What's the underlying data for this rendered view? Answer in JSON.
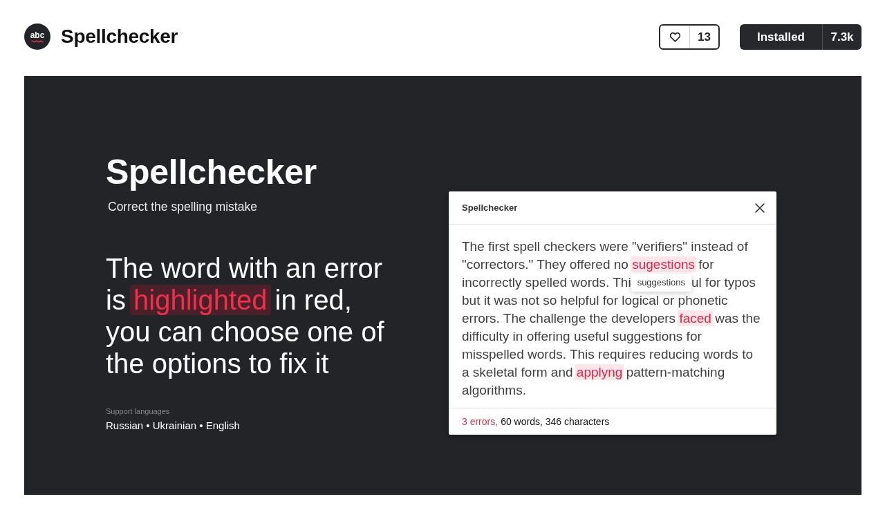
{
  "header": {
    "logo_text": "abc",
    "title": "Spellchecker",
    "like_count": "13",
    "install_label": "Installed",
    "install_count": "7.3k"
  },
  "hero": {
    "title": "Spellchecker",
    "subtitle": "Correct the spelling mistake",
    "headline": [
      {
        "kind": "text",
        "text": "The word with an error is "
      },
      {
        "kind": "error",
        "text": "highlighted"
      },
      {
        "kind": "text",
        "text": " in red, you can choose one of the options to fix it"
      }
    ],
    "languages_label": "Support languages",
    "languages": "Russian • Ukrainian • English"
  },
  "popup": {
    "title": "Spellchecker",
    "text": [
      {
        "kind": "text",
        "text": "The first spell checkers were \"verifiers\" instead of \"correctors.\" They offered no "
      },
      {
        "kind": "error",
        "text": "sugestions"
      },
      {
        "kind": "text",
        "text": " for incorrectly spelled words. Thi"
      },
      {
        "kind": "tooltip",
        "text": "suggestions"
      },
      {
        "kind": "text",
        "text": "ul for typos but it was not so helpful for logical or phonetic errors. The challenge the developers "
      },
      {
        "kind": "error",
        "text": "faced"
      },
      {
        "kind": "text",
        "text": " was the difficulty in offering useful suggestions for misspelled words. This requires reducing words to a skeletal form and "
      },
      {
        "kind": "error",
        "text": "applyng"
      },
      {
        "kind": "text",
        "text": " pattern-matching algorithms."
      }
    ],
    "errors": "3 errors,",
    "counts": "60 words, 346 characters"
  }
}
